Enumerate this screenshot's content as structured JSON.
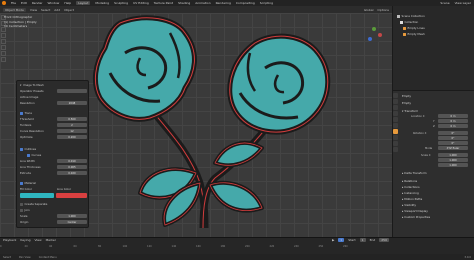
{
  "menu": {
    "items": [
      "File",
      "Edit",
      "Render",
      "Window",
      "Help"
    ],
    "workspaces": [
      "Layout",
      "Modeling",
      "Sculpting",
      "UV Editing",
      "Texture Paint",
      "Shading",
      "Animation",
      "Rendering",
      "Compositing",
      "Scripting"
    ],
    "scene": "Scene",
    "view_layer": "View Layer"
  },
  "toolbar": {
    "items": [
      "Object Mode",
      "View",
      "Select",
      "Add",
      "Object"
    ],
    "right_items": [
      "Global",
      "Options"
    ]
  },
  "viewport": {
    "info_lines": [
      "Front Orthographic",
      "(1) Collection | Empty",
      "10 Centimeters"
    ]
  },
  "operator_panel": {
    "title": "Image To Mesh",
    "rows": [
      {
        "label": "Operator Presets",
        "value": ""
      },
      {
        "label": "Active Image",
        "value": ""
      },
      {
        "label": "Resolution",
        "value": "2048"
      },
      {
        "label": "Trace",
        "value": ""
      },
      {
        "label": "Threshold",
        "value": "0.500"
      },
      {
        "label": "Turdsize",
        "value": "2"
      },
      {
        "label": "Curve Resolution",
        "value": "12"
      },
      {
        "label": "Optimize",
        "value": "0.200"
      },
      {
        "label": "Outlines",
        "value": ""
      },
      {
        "label": "Curves",
        "value": ""
      },
      {
        "label": "Line Width",
        "value": "0.010"
      },
      {
        "label": "Line Thickness",
        "value": "0.005"
      },
      {
        "label": "Extrude",
        "value": "0.020"
      },
      {
        "label": "Material",
        "value": ""
      },
      {
        "label": "Fill Color",
        "value": ""
      },
      {
        "label": "Line Color",
        "value": ""
      },
      {
        "label": "Create Separate",
        "value": ""
      },
      {
        "label": "Join",
        "value": ""
      },
      {
        "label": "Scale",
        "value": "1.000"
      },
      {
        "label": "Origin",
        "value": "Center"
      }
    ],
    "fill_color": "#2fb6c0",
    "line_color": "#d94040"
  },
  "outliner": {
    "title": "Scene Collection",
    "rows": [
      "Collection",
      "Empty Lines",
      "Empty Mesh"
    ]
  },
  "properties": {
    "object_name": "Empty",
    "sections": [
      "Transform",
      "Delta Transform",
      "Relations",
      "Collections",
      "Instancing",
      "Motion Paths",
      "Visibility",
      "Viewport Display",
      "Custom Properties"
    ],
    "transform": {
      "location": [
        "0 m",
        "0 m",
        "0 m"
      ],
      "rotation": [
        "0°",
        "0°",
        "0°"
      ],
      "mode": "XYZ Euler",
      "scale": [
        "1.000",
        "1.000",
        "1.000"
      ]
    }
  },
  "timeline": {
    "items": [
      "Playback",
      "Keying",
      "View",
      "Marker"
    ],
    "frame": "1",
    "start_label": "Start",
    "start": "1",
    "end_label": "End",
    "end": "250",
    "ticks": [
      "0",
      "20",
      "40",
      "60",
      "80",
      "100",
      "120",
      "140",
      "160",
      "180",
      "200",
      "220",
      "240",
      "250",
      "260"
    ]
  },
  "status": {
    "items": [
      "Select",
      "Pan View",
      "Context Menu"
    ],
    "version": "3.0.0"
  },
  "colors": {
    "fill": "#45a9aa",
    "outline": "#d23c3c",
    "accent": "#4a7bd0"
  }
}
